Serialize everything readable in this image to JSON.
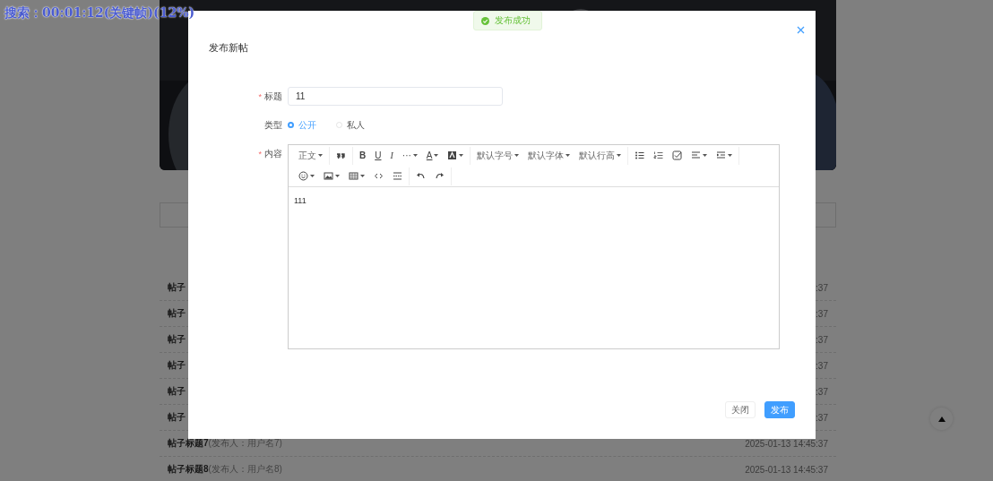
{
  "recorder_overlay": "搜索：00:01:12(关键帧)(12%)",
  "page": {
    "posts": [
      {
        "title": "帖子",
        "time": ":37"
      },
      {
        "title": "帖子",
        "time": ":37"
      },
      {
        "title": "帖子",
        "time": ":37"
      },
      {
        "title": "帖子",
        "time": ":37"
      },
      {
        "title": "帖子",
        "time": ":37"
      },
      {
        "title": "帖子",
        "time": ":37"
      },
      {
        "title": "帖子标题7",
        "publisher": "(发布人：用户名7)",
        "time": "2025-01-13 14:45:37"
      },
      {
        "title": "帖子标题8",
        "publisher": "(发布人：用户名8)",
        "time": "2025-01-13 14:45:37"
      }
    ]
  },
  "toast": {
    "message": "发布成功"
  },
  "dialog": {
    "title": "发布新帖",
    "fields": [
      {
        "kind": "input",
        "label": "标题",
        "marker": "*",
        "value": "11"
      },
      {
        "kind": "radio",
        "label": "类型",
        "options": [
          {
            "label": "公开",
            "selected": true
          },
          {
            "label": "私人",
            "selected": false
          }
        ]
      },
      {
        "kind": "editor",
        "label": "内容",
        "marker": "*",
        "content": "111",
        "toolbar_rows": [
          [
            [
              {
                "kind": "select",
                "label": "正文"
              }
            ],
            [
              {
                "kind": "icon",
                "dropdown": false
              }
            ],
            [
              {
                "kind": "bold",
                "label": "B",
                "dropdown": false
              },
              {
                "kind": "underline",
                "label": "U",
                "dropdown": false
              },
              {
                "kind": "italic",
                "label": "I",
                "dropdown": false
              },
              {
                "kind": "glyph",
                "label": "···",
                "dropdown": true
              },
              {
                "kind": "underline",
                "label": "A",
                "dropdown": true
              },
              {
                "kind": "icon",
                "dropdown": true
              }
            ],
            [
              {
                "kind": "select",
                "label": "默认字号"
              },
              {
                "kind": "select",
                "label": "默认字体"
              },
              {
                "kind": "select",
                "label": "默认行高"
              }
            ],
            [
              {
                "kind": "icon",
                "dropdown": false
              },
              {
                "kind": "icon",
                "dropdown": false
              },
              {
                "kind": "icon",
                "dropdown": false
              },
              {
                "kind": "icon",
                "dropdown": true
              },
              {
                "kind": "icon",
                "dropdown": true
              }
            ]
          ],
          [
            [
              {
                "kind": "icon",
                "dropdown": true
              },
              {
                "kind": "icon",
                "dropdown": true
              },
              {
                "kind": "icon",
                "dropdown": true
              },
              {
                "kind": "icon",
                "dropdown": false
              },
              {
                "kind": "icon",
                "dropdown": false
              }
            ],
            [
              {
                "kind": "icon",
                "dropdown": false
              },
              {
                "kind": "icon",
                "dropdown": false
              }
            ]
          ]
        ]
      }
    ],
    "buttons": [
      {
        "label": "关闭",
        "primary": false
      },
      {
        "label": "发布",
        "primary": true
      }
    ]
  }
}
